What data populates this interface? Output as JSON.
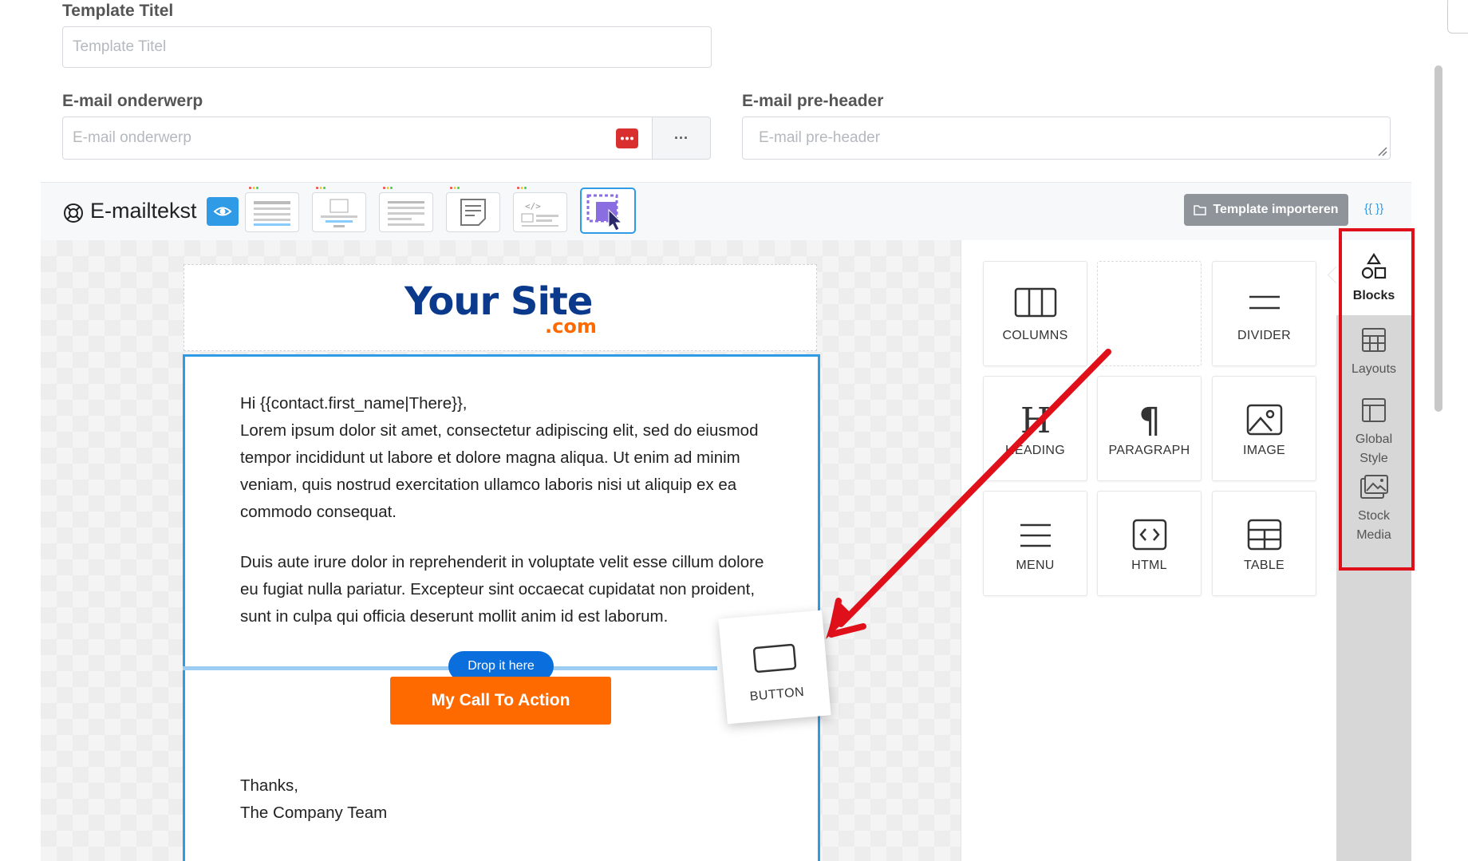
{
  "form": {
    "template_title_label": "Template Titel",
    "template_title_placeholder": "Template Titel",
    "subject_label": "E-mail onderwerp",
    "subject_placeholder": "E-mail onderwerp",
    "subject_more": "···",
    "preheader_label": "E-mail pre-header",
    "preheader_placeholder": "E-mail pre-header"
  },
  "toolbar": {
    "title": "E-mailtekst",
    "import_button": "Template importeren",
    "merge_tags": "{{ }}"
  },
  "email": {
    "logo_main": "Your Site",
    "logo_suffix": ".com",
    "greeting": "Hi {{contact.first_name|There}},",
    "para1": "Lorem ipsum dolor sit amet, consectetur adipiscing elit, sed do eiusmod tempor incididunt ut labore et dolore magna aliqua. Ut enim ad minim veniam, quis nostrud exercitation ullamco laboris nisi ut aliquip ex ea commodo consequat.",
    "para2": "Duis aute irure dolor in reprehenderit in voluptate velit esse cillum dolore eu fugiat nulla pariatur. Excepteur sint occaecat cupidatat non proident, sunt in culpa qui officia deserunt mollit anim id est laborum.",
    "drop_hint": "Drop it here",
    "cta": "My Call To Action",
    "thanks": "Thanks,",
    "signature": "The Company Team"
  },
  "blocks": {
    "columns": "COLUMNS",
    "divider": "DIVIDER",
    "heading": "HEADING",
    "paragraph": "PARAGRAPH",
    "image": "IMAGE",
    "menu": "MENU",
    "html": "HTML",
    "table": "TABLE",
    "dragging": "BUTTON"
  },
  "tabs": {
    "blocks": "Blocks",
    "layouts": "Layouts",
    "global_style_1": "Global",
    "global_style_2": "Style",
    "stock_media_1": "Stock",
    "stock_media_2": "Media"
  },
  "colors": {
    "accent_blue": "#2f9be6",
    "cta_orange": "#ff6a00",
    "drop_blue": "#0a6edc",
    "highlight_red": "#e0101a",
    "logo_navy": "#0b3a8c"
  }
}
